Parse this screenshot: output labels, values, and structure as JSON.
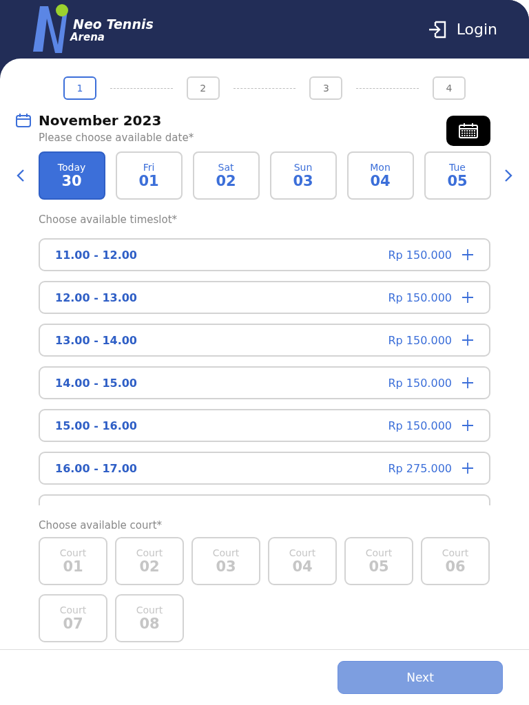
{
  "header": {
    "brand_line_1": "Neo Tennis",
    "brand_line_2": "Arena",
    "login": "Login"
  },
  "steps": [
    {
      "label": "1",
      "selected": true
    },
    {
      "label": "2",
      "selected": false
    },
    {
      "label": "3",
      "selected": false
    },
    {
      "label": "4",
      "selected": false
    }
  ],
  "month": "November 2023",
  "date_hint": "Please choose available date*",
  "dates": [
    {
      "day": "Today",
      "date": "30",
      "selected": true
    },
    {
      "day": "Fri",
      "date": "01",
      "selected": false
    },
    {
      "day": "Sat",
      "date": "02",
      "selected": false
    },
    {
      "day": "Sun",
      "date": "03",
      "selected": false
    },
    {
      "day": "Mon",
      "date": "04",
      "selected": false
    },
    {
      "day": "Tue",
      "date": "05",
      "selected": false
    }
  ],
  "timeslot_hint": "Choose available timeslot*",
  "timeslots": [
    {
      "time": "11.00 - 12.00",
      "price": "Rp 150.000"
    },
    {
      "time": "12.00 - 13.00",
      "price": "Rp 150.000"
    },
    {
      "time": "13.00 - 14.00",
      "price": "Rp 150.000"
    },
    {
      "time": "14.00 - 15.00",
      "price": "Rp 150.000"
    },
    {
      "time": "15.00 - 16.00",
      "price": "Rp 150.000"
    },
    {
      "time": "16.00 - 17.00",
      "price": "Rp 275.000"
    }
  ],
  "timeslots_more_below": true,
  "court_hint": "Choose available court*",
  "courts": [
    {
      "label": "Court",
      "number": "01",
      "disabled": true
    },
    {
      "label": "Court",
      "number": "02",
      "disabled": true
    },
    {
      "label": "Court",
      "number": "03",
      "disabled": true
    },
    {
      "label": "Court",
      "number": "04",
      "disabled": true
    },
    {
      "label": "Court",
      "number": "05",
      "disabled": true
    },
    {
      "label": "Court",
      "number": "06",
      "disabled": true
    },
    {
      "label": "Court",
      "number": "07",
      "disabled": true
    },
    {
      "label": "Court",
      "number": "08",
      "disabled": true
    }
  ],
  "next_button": {
    "label": "Next",
    "disabled": true
  }
}
